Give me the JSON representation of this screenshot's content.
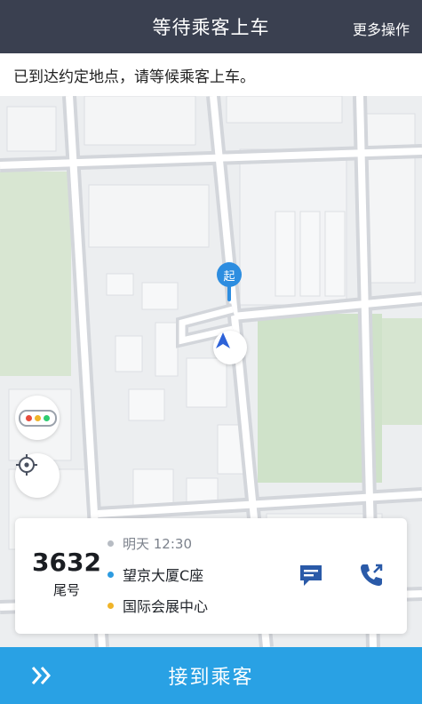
{
  "header": {
    "title": "等待乘客上车",
    "more_label": "更多操作"
  },
  "notice": {
    "text": "已到达约定地点，请等候乘客上车。"
  },
  "map": {
    "pickup_marker_label": "起",
    "traffic_button_icon": "traffic-light-icon",
    "locate_button_icon": "locate-crosshair-icon",
    "nav_marker_icon": "navigation-arrow-icon"
  },
  "order": {
    "tail_number": "3632",
    "tail_label": "尾号",
    "time": "明天 12:30",
    "start": "望京大厦C座",
    "destination": "国际会展中心",
    "message_icon": "message-icon",
    "call_icon": "phone-call-icon"
  },
  "action": {
    "label": "接到乘客",
    "icon": "double-chevron-right-icon"
  },
  "colors": {
    "header_bg": "#3a4050",
    "action_bg": "#29a1e4",
    "accent_blue": "#2d8de0",
    "start_dot": "#2d9be0",
    "destination_dot": "#f0b429",
    "time_dot": "#b7bcc3",
    "park_green": "#cfe2c9"
  }
}
